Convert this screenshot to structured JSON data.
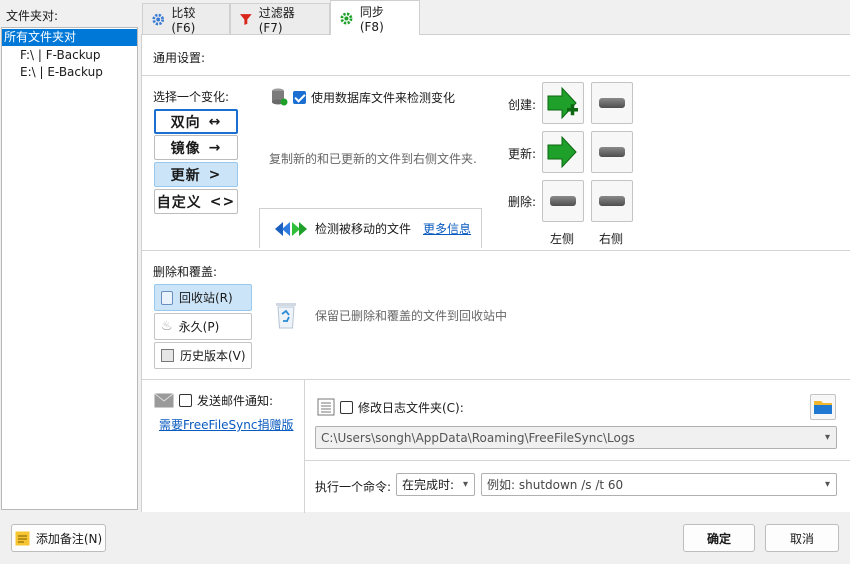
{
  "left_panel": {
    "title": "文件夹对:",
    "items": [
      "所有文件夹对",
      "F:\\ | F-Backup",
      "E:\\ | E-Backup"
    ]
  },
  "tabs": [
    {
      "label": "比较 (F6)",
      "icon": "gear-icon"
    },
    {
      "label": "过滤器 (F7)",
      "icon": "funnel-icon"
    },
    {
      "label": "同步 (F8)",
      "icon": "sync-gear-icon"
    }
  ],
  "general_settings": "通用设置:",
  "variant": {
    "label": "选择一个变化:",
    "options": [
      {
        "label": "双向",
        "glyph": "↔"
      },
      {
        "label": "镜像",
        "glyph": "→"
      },
      {
        "label": "更新",
        "glyph": ">"
      },
      {
        "label": "自定义",
        "glyph": "<>"
      }
    ],
    "selected": "更新",
    "db_checkbox": "使用数据库文件来检测变化",
    "description": "复制新的和已更新的文件到右侧文件夹.",
    "detect_moved": "检测被移动的文件",
    "more_info": "更多信息"
  },
  "actions": {
    "create": "创建:",
    "update": "更新:",
    "delete": "删除:",
    "left": "左侧",
    "right": "右侧"
  },
  "deletion": {
    "label": "删除和覆盖:",
    "options": [
      "回收站(R)",
      "永久(P)",
      "历史版本(V)"
    ],
    "selected": "回收站(R)",
    "description": "保留已删除和覆盖的文件到回收站中"
  },
  "email": {
    "checkbox": "发送邮件通知:",
    "link": "需要FreeFileSync捐赠版"
  },
  "log": {
    "checkbox": "修改日志文件夹(C):",
    "path": "C:\\Users\\songh\\AppData\\Roaming\\FreeFileSync\\Logs"
  },
  "command": {
    "label": "执行一个命令:",
    "when": "在完成时:",
    "placeholder": "例如: shutdown /s /t 60"
  },
  "footer": {
    "add_note": "添加备注(N)",
    "ok": "确定",
    "cancel": "取消"
  },
  "colors": {
    "accent": "#0078d7",
    "selection": "#cce4f7",
    "green": "#1fa02a"
  }
}
